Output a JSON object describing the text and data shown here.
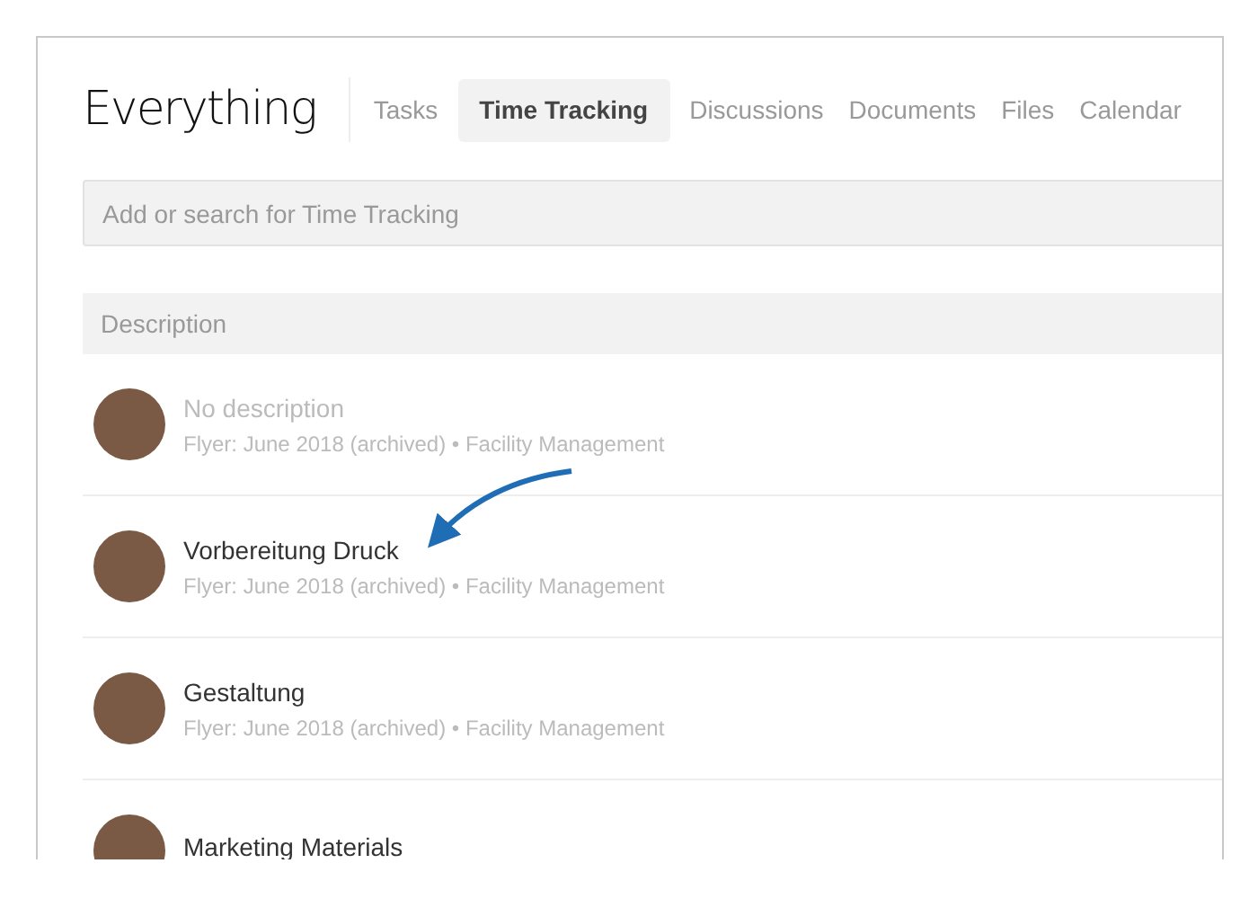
{
  "header": {
    "title": "Everything"
  },
  "tabs": [
    {
      "label": "Tasks",
      "selected": false
    },
    {
      "label": "Time Tracking",
      "selected": true
    },
    {
      "label": "Discussions",
      "selected": false
    },
    {
      "label": "Documents",
      "selected": false
    },
    {
      "label": "Files",
      "selected": false
    },
    {
      "label": "Calendar",
      "selected": false
    }
  ],
  "search": {
    "placeholder": "Add or search for Time Tracking"
  },
  "table": {
    "columns": [
      "Description"
    ],
    "rows": [
      {
        "description": "No description",
        "muted": true,
        "meta": "Flyer: June 2018 (archived) • Facility Management"
      },
      {
        "description": "Vorbereitung Druck",
        "muted": false,
        "meta": "Flyer: June 2018 (archived) • Facility Management"
      },
      {
        "description": "Gestaltung",
        "muted": false,
        "meta": "Flyer: June 2018 (archived) • Facility Management"
      },
      {
        "description": "Marketing Materials",
        "muted": false
      }
    ]
  }
}
